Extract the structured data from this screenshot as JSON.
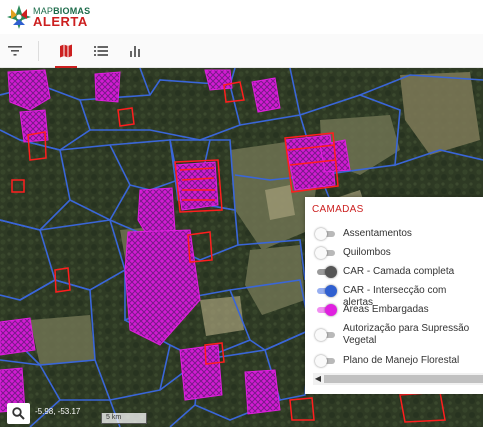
{
  "brand": {
    "logo_top_light": "MAP",
    "logo_top_bold": "BIOMAS",
    "logo_bottom": "ALERTA"
  },
  "toolbar": {
    "items": [
      {
        "name": "filter",
        "icon": "filter-icon"
      },
      {
        "name": "map",
        "icon": "map-icon",
        "active": true
      },
      {
        "name": "list",
        "icon": "list-icon"
      },
      {
        "name": "chart",
        "icon": "bar-chart-icon"
      }
    ]
  },
  "layers_panel": {
    "title": "CAMADAS",
    "layers": [
      {
        "label": "Assentamentos",
        "enabled": false
      },
      {
        "label": "Quilombos",
        "enabled": false
      },
      {
        "label": "CAR - Camada completa",
        "enabled": true,
        "color": "#555555"
      },
      {
        "label": "CAR - Intersecção com alertas",
        "enabled": true,
        "color": "#2f5fd0"
      },
      {
        "label": "Áreas Embargadas",
        "enabled": true,
        "color": "#e020e0"
      },
      {
        "label": "Autorização para Supressão Vegetal",
        "enabled": false
      },
      {
        "label": "Plano de Manejo Florestal",
        "enabled": false
      }
    ]
  },
  "map": {
    "coordinates": "-5.98, -53.17",
    "scale_label": "5 km"
  },
  "colors": {
    "accent": "#cc1f1f",
    "car_outline": "#3a66d8",
    "embargo_fill": "#d21bd2",
    "alert": "#ff1e1e"
  }
}
